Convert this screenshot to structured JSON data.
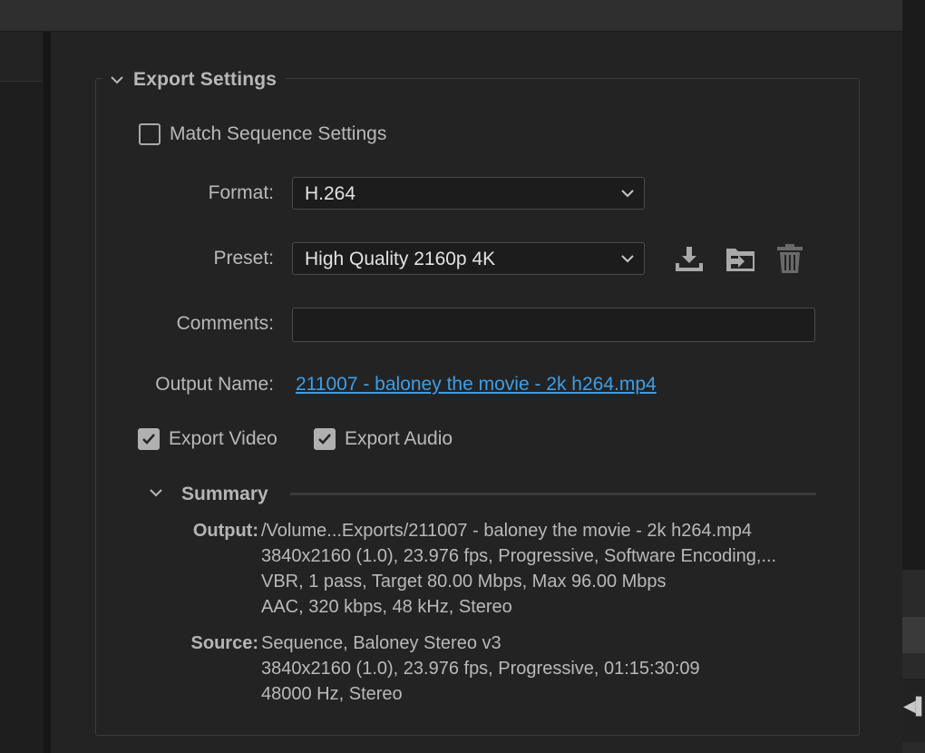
{
  "export_settings": {
    "title": "Export Settings",
    "match_sequence": {
      "label": "Match Sequence Settings",
      "checked": false
    },
    "format": {
      "label": "Format:",
      "value": "H.264"
    },
    "preset": {
      "label": "Preset:",
      "value": "High Quality 2160p 4K"
    },
    "comments": {
      "label": "Comments:",
      "value": ""
    },
    "output_name": {
      "label": "Output Name:",
      "value": "211007 - baloney the movie - 2k h264.mp4"
    },
    "export_video": {
      "label": "Export Video",
      "checked": true
    },
    "export_audio": {
      "label": "Export Audio",
      "checked": true
    },
    "preset_icons": [
      "save-preset-icon",
      "import-preset-icon",
      "delete-preset-icon"
    ]
  },
  "summary": {
    "title": "Summary",
    "output": {
      "key": "Output:",
      "lines": [
        "/Volume...Exports/211007 - baloney the movie - 2k h264.mp4",
        "3840x2160 (1.0), 23.976 fps, Progressive, Software Encoding,...",
        "VBR, 1 pass, Target 80.00 Mbps, Max 96.00 Mbps",
        "AAC, 320 kbps, 48 kHz, Stereo"
      ]
    },
    "source": {
      "key": "Source:",
      "lines": [
        "Sequence, Baloney Stereo v3",
        "3840x2160 (1.0), 23.976 fps, Progressive, 01:15:30:09",
        "48000 Hz, Stereo"
      ]
    }
  },
  "edge_glyph": "◀▌",
  "colors": {
    "background": "#232323",
    "link": "#3e9ee8",
    "text": "#b9b9b9"
  }
}
